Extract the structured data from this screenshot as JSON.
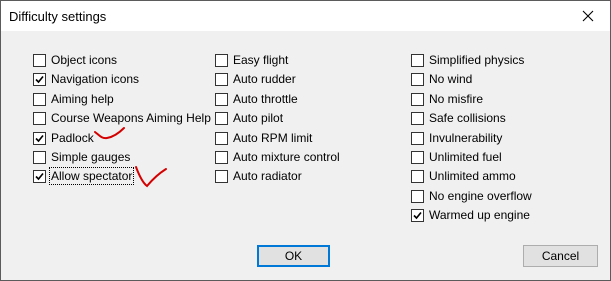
{
  "dialog": {
    "title": "Difficulty settings",
    "close_icon": "close-icon"
  },
  "columns": [
    [
      {
        "label": "Object icons",
        "checked": false
      },
      {
        "label": "Navigation icons",
        "checked": true
      },
      {
        "label": "Aiming help",
        "checked": false
      },
      {
        "label": "Course Weapons Aiming Help",
        "checked": false
      },
      {
        "label": "Padlock",
        "checked": true
      },
      {
        "label": "Simple gauges",
        "checked": false
      },
      {
        "label": "Allow spectator",
        "checked": true,
        "focused": true
      }
    ],
    [
      {
        "label": "Easy flight",
        "checked": false
      },
      {
        "label": "Auto rudder",
        "checked": false
      },
      {
        "label": "Auto throttle",
        "checked": false
      },
      {
        "label": "Auto pilot",
        "checked": false
      },
      {
        "label": "Auto RPM limit",
        "checked": false
      },
      {
        "label": "Auto mixture control",
        "checked": false
      },
      {
        "label": "Auto radiator",
        "checked": false
      }
    ],
    [
      {
        "label": "Simplified physics",
        "checked": false
      },
      {
        "label": "No wind",
        "checked": false
      },
      {
        "label": "No misfire",
        "checked": false
      },
      {
        "label": "Safe collisions",
        "checked": false
      },
      {
        "label": "Invulnerability",
        "checked": false
      },
      {
        "label": "Unlimited fuel",
        "checked": false
      },
      {
        "label": "Unlimited ammo",
        "checked": false
      },
      {
        "label": "No engine overflow",
        "checked": false
      },
      {
        "label": "Warmed up engine",
        "checked": true
      }
    ]
  ],
  "buttons": {
    "ok": "OK",
    "cancel": "Cancel"
  },
  "annotations": {
    "color": "#d40000"
  }
}
